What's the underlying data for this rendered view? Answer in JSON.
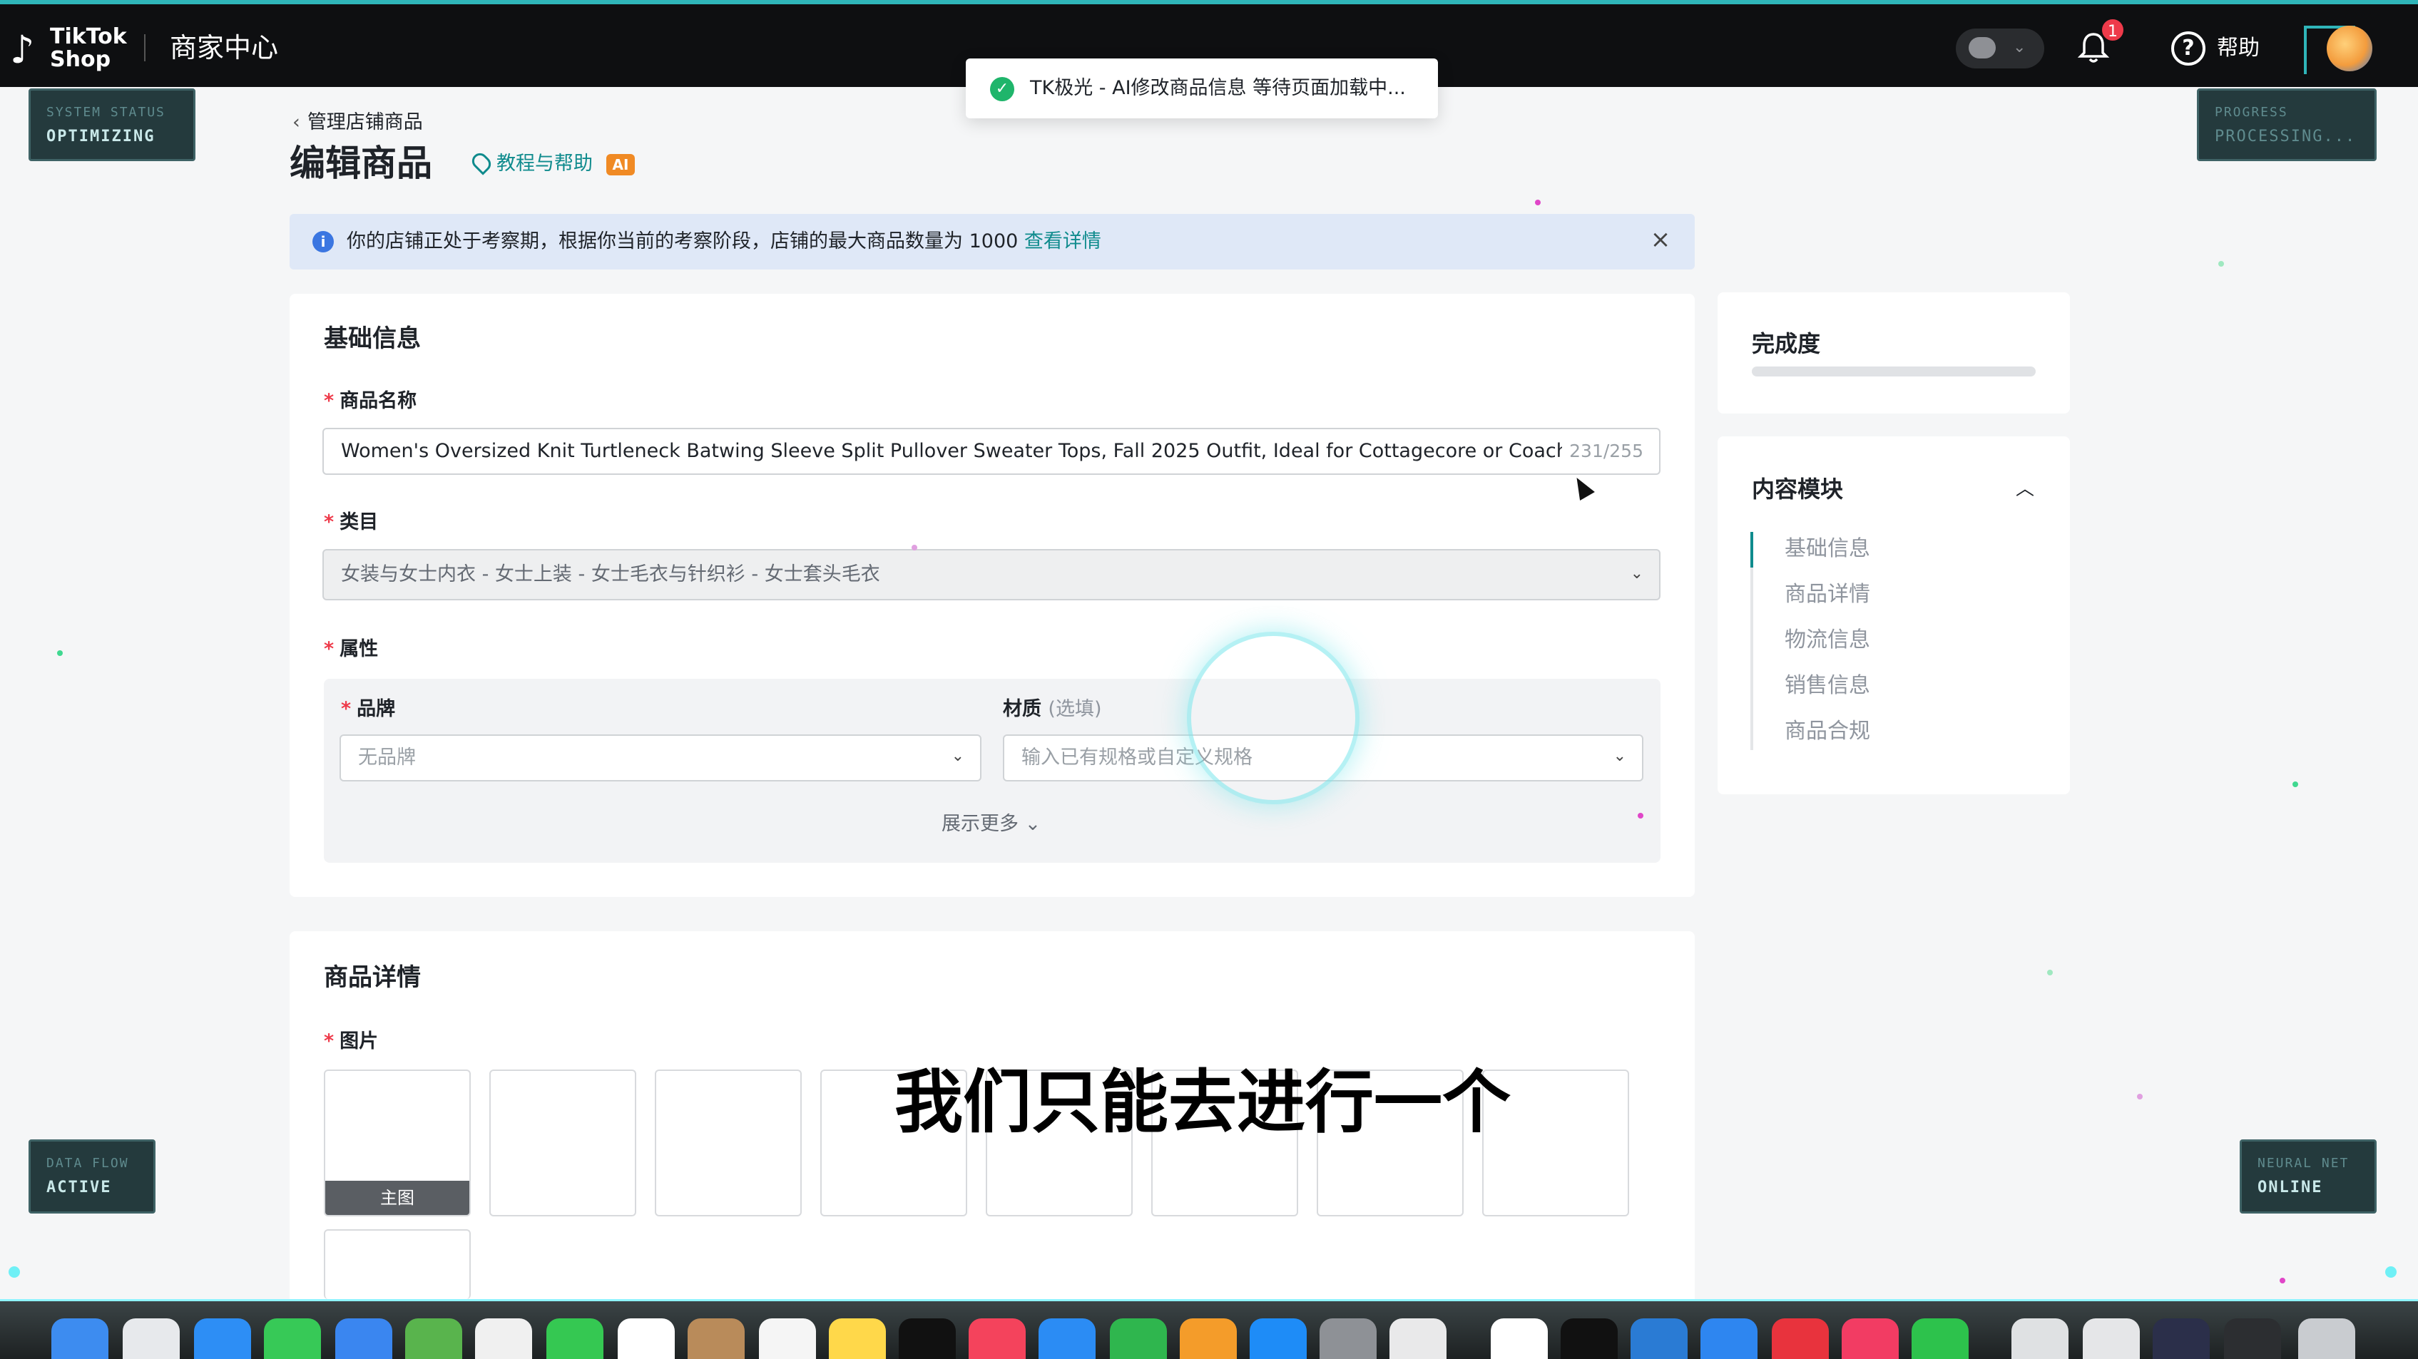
{
  "topbar": {
    "logo_line1": "TikTok",
    "logo_line2": "Shop",
    "brand_title": "商家中心",
    "notification_count": "1",
    "help_label": "帮助"
  },
  "hud": {
    "system_status_label": "SYSTEM STATUS",
    "system_status_value": "OPTIMIZING",
    "progress_label": "PROGRESS",
    "progress_value": "PROCESSING...",
    "data_flow_label": "DATA FLOW",
    "data_flow_value": "ACTIVE",
    "neural_net_label": "NEURAL NET",
    "neural_net_value": "ONLINE"
  },
  "toast": {
    "text": "TK极光 - AI修改商品信息 等待页面加载中..."
  },
  "breadcrumb": "管理店铺商品",
  "page_title": "编辑商品",
  "tutorial_link": "教程与帮助",
  "ai_badge": "AI",
  "notice": {
    "text": "你的店铺正处于考察期，根据你当前的考察阶段，店铺的最大商品数量为 1000",
    "link": "查看详情"
  },
  "basic_info": {
    "title": "基础信息",
    "product_name_label": "商品名称",
    "product_name_value": "Women's Oversized Knit Turtleneck Batwing Sleeve Split Pullover Sweater Tops, Fall 2025 Outfit, Ideal for Cottagecore or Coachella n",
    "product_name_count": "231/255",
    "category_label": "类目",
    "category_value": "女装与女士内衣 - 女士上装 - 女士毛衣与针织衫 - 女士套头毛衣",
    "attributes_label": "属性",
    "brand_label": "品牌",
    "brand_placeholder": "无品牌",
    "material_label": "材质",
    "material_optional": "(选填)",
    "material_placeholder": "输入已有规格或自定义规格",
    "show_more": "展示更多"
  },
  "product_details": {
    "title": "商品详情",
    "images_label": "图片",
    "main_image_tag": "主图"
  },
  "completeness": {
    "title": "完成度",
    "progress": 0
  },
  "content_modules": {
    "title": "内容模块",
    "items": [
      "基础信息",
      "商品详情",
      "物流信息",
      "销售信息",
      "商品合规"
    ]
  },
  "video_subtitle": "我们只能去进行一个",
  "colors": {
    "accent": "#0f8b8d",
    "required": "#ee3a4a",
    "notice_bg": "#dfe8f7",
    "topbar": "#0e0f11"
  }
}
